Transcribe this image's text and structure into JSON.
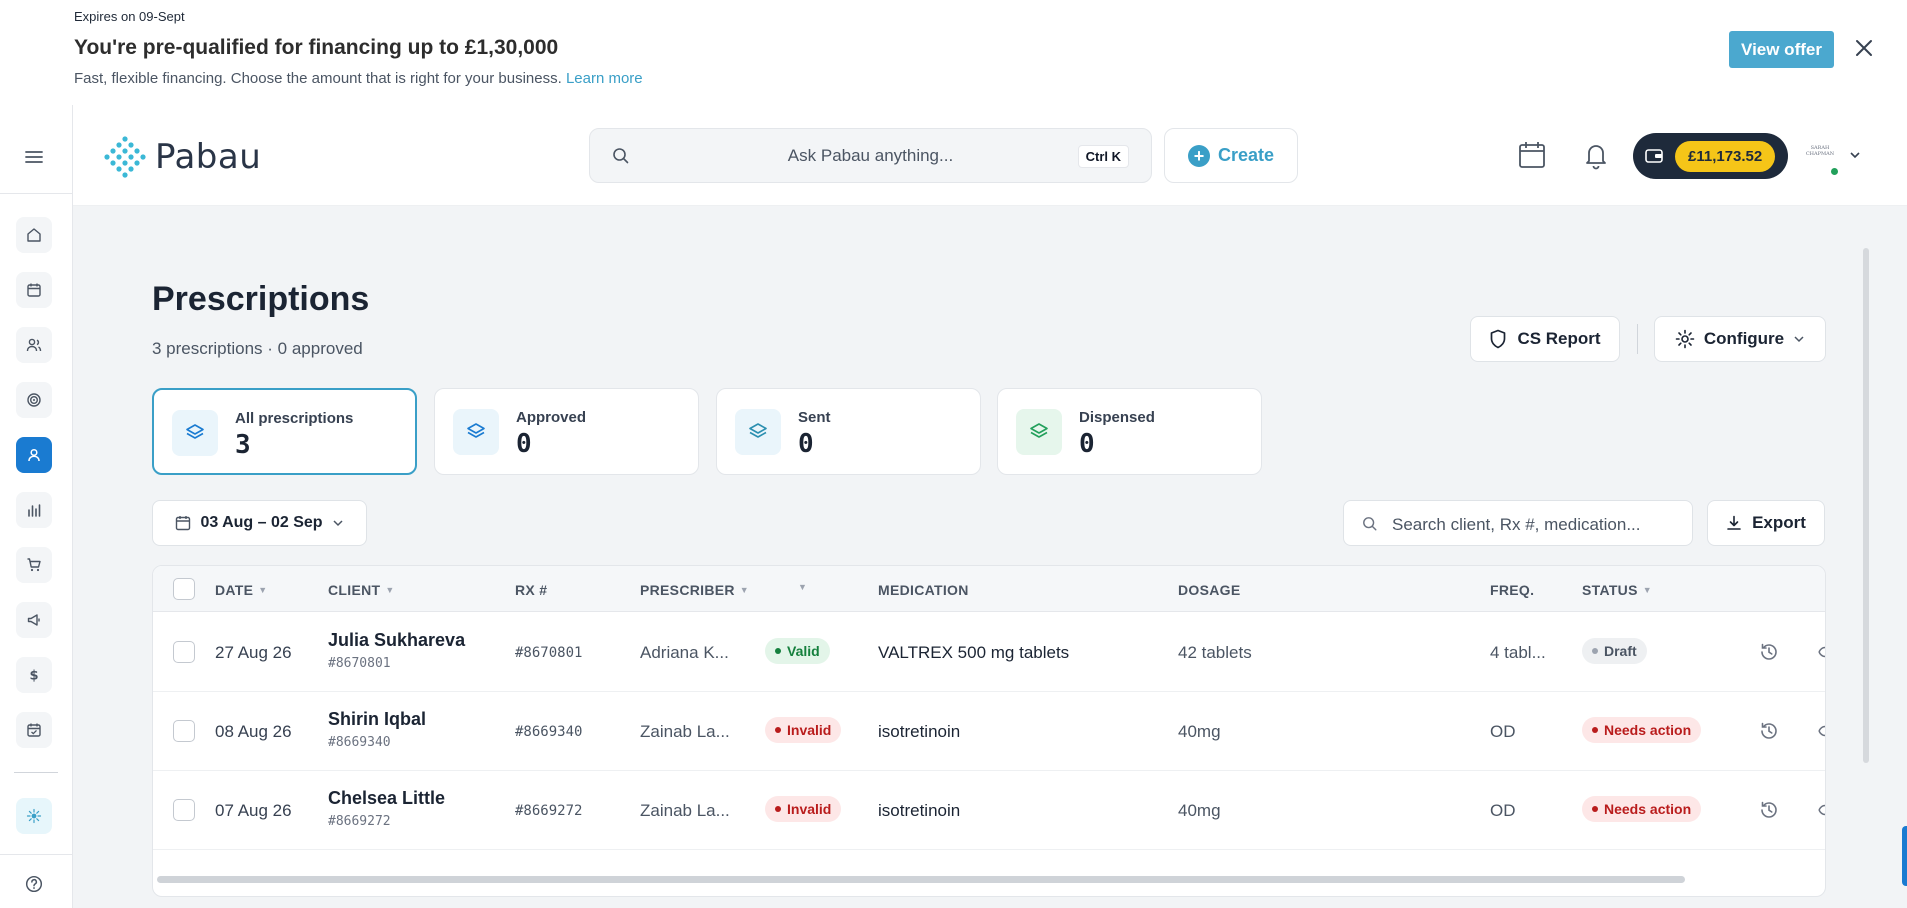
{
  "banner": {
    "expires": "Expires on 09-Sept",
    "headline": "You're pre-qualified for financing up to £1,30,000",
    "subtext": "Fast, flexible financing. Choose the amount that is right for your business.",
    "learn_more": "Learn more",
    "view_offer": "View offer"
  },
  "header": {
    "logo": "Pabau",
    "search_placeholder": "Ask Pabau anything...",
    "shortcut": "Ctrl K",
    "create": "Create",
    "wallet_amount": "£11,173.52",
    "avatar_text": "SARAH CHAPMAN"
  },
  "page": {
    "title": "Prescriptions",
    "subtitle": "3 prescriptions · 0 approved",
    "cs_report": "CS Report",
    "configure": "Configure"
  },
  "stats": [
    {
      "label": "All prescriptions",
      "value": "3"
    },
    {
      "label": "Approved",
      "value": "0"
    },
    {
      "label": "Sent",
      "value": "0"
    },
    {
      "label": "Dispensed",
      "value": "0"
    }
  ],
  "filters": {
    "date_range": "03 Aug – 02 Sep",
    "search_placeholder": "Search client, Rx #, medication...",
    "export": "Export"
  },
  "table": {
    "columns": {
      "date": "DATE",
      "client": "CLIENT",
      "rx": "RX #",
      "prescriber": "PRESCRIBER",
      "medication": "MEDICATION",
      "dosage": "DOSAGE",
      "freq": "FREQ.",
      "status": "STATUS"
    },
    "rows": [
      {
        "date": "27 Aug 26",
        "client": "Julia Sukhareva",
        "client_id": "#8670801",
        "rx": "#8670801",
        "prescriber": "Adriana K...",
        "validity": "Valid",
        "medication": "VALTREX 500 mg tablets",
        "dosage": "42 tablets",
        "freq": "4 tabl...",
        "status": "Draft"
      },
      {
        "date": "08 Aug 26",
        "client": "Shirin Iqbal",
        "client_id": "#8669340",
        "rx": "#8669340",
        "prescriber": "Zainab La...",
        "validity": "Invalid",
        "medication": "isotretinoin",
        "dosage": "40mg",
        "freq": "OD",
        "status": "Needs action"
      },
      {
        "date": "07 Aug 26",
        "client": "Chelsea Little",
        "client_id": "#8669272",
        "rx": "#8669272",
        "prescriber": "Zainab La...",
        "validity": "Invalid",
        "medication": "isotretinoin",
        "dosage": "40mg",
        "freq": "OD",
        "status": "Needs action"
      }
    ]
  },
  "colors": {
    "accent": "#3a9fc7",
    "rail_active": "#1a7bd1",
    "wallet_bg": "#1e2a3b",
    "wallet_amount": "#f5c518"
  }
}
